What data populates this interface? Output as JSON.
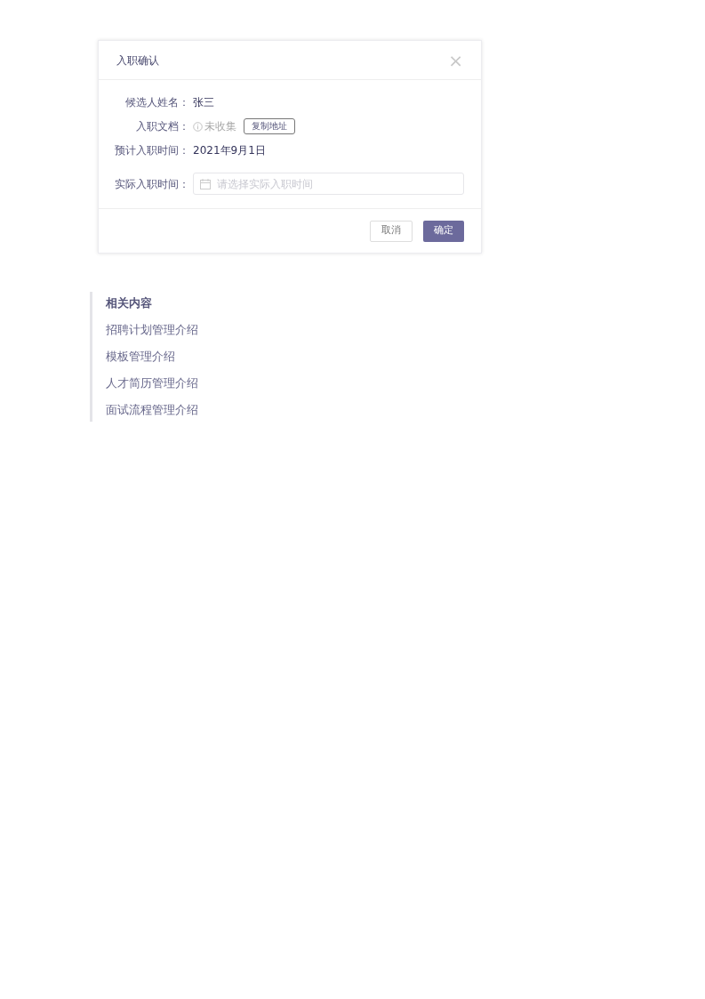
{
  "dialog": {
    "title": "入职确认",
    "close": "×",
    "fields": [
      {
        "kind": "text",
        "label": "候选人姓名：",
        "value": "张三"
      },
      {
        "kind": "document",
        "label": "入职文档：",
        "status": "未收集",
        "button": "复制地址"
      },
      {
        "kind": "text",
        "label": "预计入职时间：",
        "value": "2021年9月1日"
      },
      {
        "kind": "date",
        "label": "实际入职时间：",
        "placeholder": "请选择实际入职时间"
      }
    ],
    "buttons": [
      {
        "label": "取消",
        "primary": false
      },
      {
        "label": "确定",
        "primary": true
      }
    ]
  },
  "related": {
    "title": "相关内容",
    "links": [
      "招聘计划管理介绍",
      "模板管理介绍",
      "人才简历管理介绍",
      "面试流程管理介绍"
    ]
  }
}
